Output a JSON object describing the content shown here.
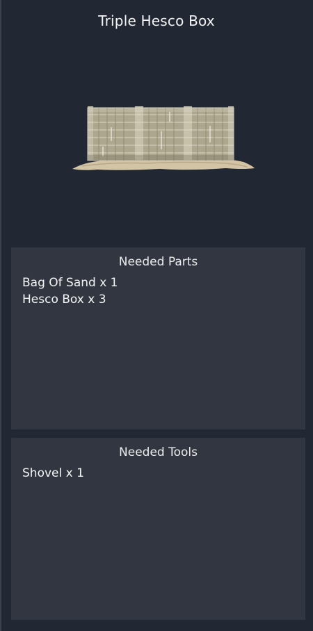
{
  "title": "Triple Hesco Box",
  "preview": {
    "icon": "hesco-barrier-model"
  },
  "parts_panel": {
    "title": "Needed Parts",
    "items": [
      "Bag Of Sand x 1",
      "Hesco Box x 3"
    ]
  },
  "tools_panel": {
    "title": "Needed Tools",
    "items": [
      "Shovel x 1"
    ]
  }
}
